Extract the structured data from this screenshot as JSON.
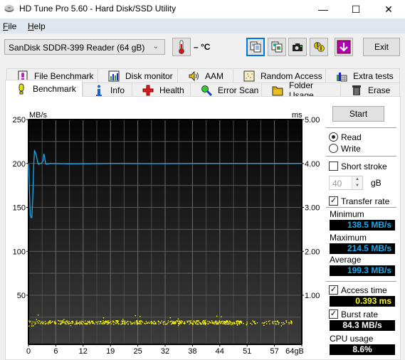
{
  "window": {
    "title": "HD Tune Pro 5.60 - Hard Disk/SSD Utility",
    "minimize_glyph": "—",
    "maximize_glyph": "☐",
    "close_glyph": "✕"
  },
  "menu": {
    "items": [
      {
        "label": "File",
        "accel": "F",
        "rest": "ile"
      },
      {
        "label": "Help",
        "accel": "H",
        "rest": "elp"
      }
    ]
  },
  "toolbar": {
    "drive": "SanDisk SDDR-399 Reader (64 gB)",
    "temperature": "– °C",
    "icons": [
      "copy-text-icon",
      "copy-screenshot-icon",
      "camera-icon",
      "options-icon",
      "save-download-icon"
    ],
    "exit_label": "Exit"
  },
  "tabs": {
    "row1": [
      "File Benchmark",
      "Disk monitor",
      "AAM",
      "Random Access",
      "Extra tests"
    ],
    "row2": [
      "Benchmark",
      "Info",
      "Health",
      "Error Scan",
      "Folder Usage",
      "Erase"
    ],
    "active": "Benchmark"
  },
  "side": {
    "start_label": "Start",
    "read_label": "Read",
    "write_label": "Write",
    "mode": "Read",
    "short_stroke_label": "Short stroke",
    "short_stroke_checked": false,
    "short_stroke_value": "40",
    "short_stroke_unit": "gB",
    "transfer_rate_label": "Transfer rate",
    "transfer_rate_checked": true,
    "minimum_label": "Minimum",
    "minimum_value": "138.5 MB/s",
    "maximum_label": "Maximum",
    "maximum_value": "214.5 MB/s",
    "average_label": "Average",
    "average_value": "199.3 MB/s",
    "access_time_label": "Access time",
    "access_time_checked": true,
    "access_time_value": "0.393 ms",
    "burst_rate_label": "Burst rate",
    "burst_rate_checked": true,
    "burst_rate_value": "84.3 MB/s",
    "cpu_label": "CPU usage",
    "cpu_value": "8.6%",
    "colors": {
      "transfer": "#1ea8e8",
      "access": "#ffff00",
      "white": "#ffffff"
    }
  },
  "chart_data": {
    "type": "line",
    "title": "",
    "xlabel": "gB",
    "ylabel": "MB/s",
    "y2label": "ms",
    "xlim": [
      0,
      64
    ],
    "ylim": [
      0,
      250
    ],
    "y2lim": [
      0,
      5
    ],
    "x_ticks": [
      "0",
      "6",
      "12",
      "19",
      "25",
      "32",
      "38",
      "44",
      "51",
      "57",
      "64gB"
    ],
    "x_tick_values": [
      0,
      6.4,
      12.8,
      19.2,
      25.6,
      32,
      38.4,
      44.8,
      51.2,
      57.6,
      64
    ],
    "y_ticks": [
      "250",
      "200",
      "150",
      "100",
      "50"
    ],
    "y_tick_values": [
      250,
      200,
      150,
      100,
      50
    ],
    "y2_ticks": [
      "5.00",
      "4.00",
      "3.00",
      "2.00",
      "1.00"
    ],
    "y2_tick_values": [
      5,
      4,
      3,
      2,
      1
    ],
    "grid": true,
    "series": [
      {
        "name": "Transfer rate",
        "color": "#1ea8e8",
        "x": [
          0,
          0.2,
          0.4,
          0.6,
          0.8,
          1.0,
          1.2,
          1.4,
          1.6,
          1.8,
          2.0,
          2.2,
          2.4,
          2.6,
          3.0,
          3.4,
          3.6,
          3.8,
          4.0,
          4.2,
          5,
          10,
          20,
          30,
          40,
          50,
          60,
          64
        ],
        "y": [
          200,
          172,
          142,
          138.5,
          138.5,
          160,
          195,
          214.5,
          213,
          210,
          205,
          200,
          199,
          200,
          200,
          203,
          211,
          207,
          200,
          199,
          200,
          199.5,
          200,
          199.8,
          200,
          200,
          200,
          200
        ]
      },
      {
        "name": "Access time",
        "color": "#ffff00",
        "unit": "ms",
        "style": "scatter",
        "approx_mean_ms": 0.393,
        "approx_range_ms": [
          0.3,
          0.5
        ],
        "x_extent": [
          0,
          62
        ]
      }
    ]
  }
}
